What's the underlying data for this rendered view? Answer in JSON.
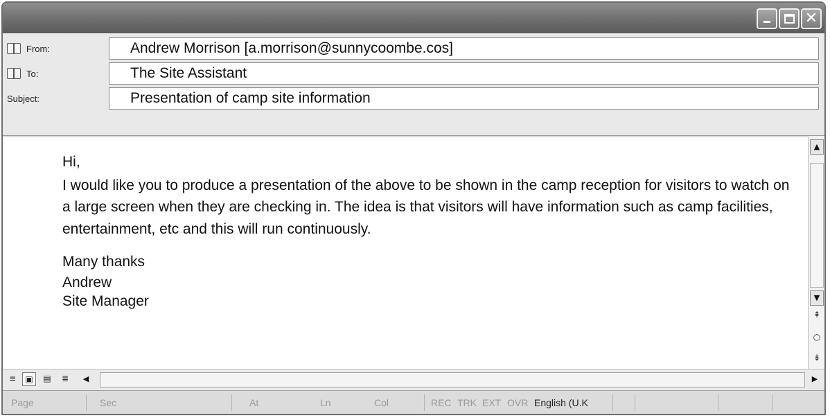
{
  "titlebar": {
    "minimize_glyph": "_",
    "maximize_glyph": "□",
    "close_glyph": "✕"
  },
  "header": {
    "from_label": "From:",
    "from_value": "Andrew Morrison [a.morrison@sunnycoombe.cos]",
    "to_label": "To:",
    "to_value": "The Site Assistant",
    "subject_label": "Subject:",
    "subject_value": "Presentation of camp site information"
  },
  "body": {
    "greeting": "Hi,",
    "paragraph": "I would like you to produce a presentation of the above to be shown in the camp reception for visitors to watch on a large screen when they are checking in. The idea is that visitors will have information such as camp facilities, entertainment, etc and this will run continuously.",
    "closing": "Many thanks",
    "sig_name": "Andrew",
    "sig_title": "Site Manager"
  },
  "scroll": {
    "up": "▲",
    "down": "▼",
    "prev_page": "⇞",
    "browse": "○",
    "next_page": "⇟",
    "left": "◀",
    "right": "▶"
  },
  "view_buttons": [
    "≡",
    "▣",
    "▤",
    "≣"
  ],
  "status": {
    "page": "Page",
    "sec": "Sec",
    "at": "At",
    "ln": "Ln",
    "col": "Col",
    "rec": "REC",
    "trk": "TRK",
    "ext": "EXT",
    "ovr": "OVR",
    "language": "English (U.K"
  },
  "icons": [
    "address-book-icon",
    "minimize-icon",
    "maximize-icon",
    "close-icon"
  ]
}
